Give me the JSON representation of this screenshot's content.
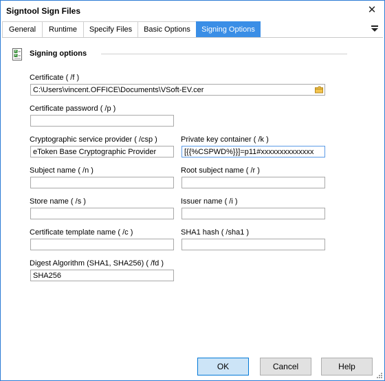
{
  "window": {
    "title": "Signtool Sign Files"
  },
  "tabs": [
    {
      "label": "General"
    },
    {
      "label": "Runtime"
    },
    {
      "label": "Specify Files"
    },
    {
      "label": "Basic Options"
    },
    {
      "label": "Signing Options",
      "active": true
    }
  ],
  "group": {
    "title": "Signing options",
    "icon": "checklist-icon"
  },
  "fields": {
    "certificate": {
      "label": "Certificate ( /f )",
      "value": "C:\\Users\\vincent.OFFICE\\Documents\\VSoft-EV.cer",
      "icon": "folder-icon"
    },
    "certificate_password": {
      "label": "Certificate password ( /p )",
      "value": ""
    },
    "csp": {
      "label": "Cryptographic service provider ( /csp )",
      "value": "eToken Base Cryptographic Provider"
    },
    "private_key_container": {
      "label": "Private key container ( /k )",
      "value": "[{{%CSPWD%}}]=p11#xxxxxxxxxxxxxx"
    },
    "subject_name": {
      "label": "Subject name ( /n )",
      "value": ""
    },
    "root_subject_name": {
      "label": "Root subject name ( /r )",
      "value": ""
    },
    "store_name": {
      "label": "Store name ( /s )",
      "value": ""
    },
    "issuer_name": {
      "label": "Issuer name ( /i )",
      "value": ""
    },
    "certificate_template_name": {
      "label": "Certificate template name ( /c )",
      "value": ""
    },
    "sha1_hash": {
      "label": "SHA1 hash ( /sha1 )",
      "value": ""
    },
    "digest_algorithm": {
      "label": "Digest Algorithm (SHA1, SHA256)  ( /fd )",
      "value": "SHA256"
    }
  },
  "buttons": {
    "ok": "OK",
    "cancel": "Cancel",
    "help": "Help"
  },
  "colors": {
    "active_tab": "#3a8ee6",
    "window_border": "#2b7bd4",
    "ok_button": "#cce4f7"
  }
}
